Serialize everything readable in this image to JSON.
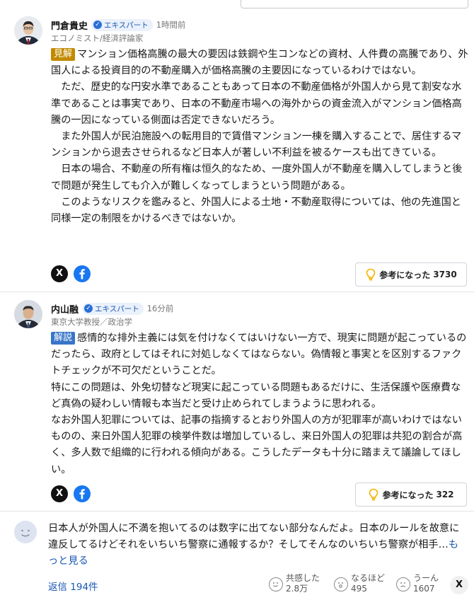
{
  "comments": [
    {
      "name": "門倉貴史",
      "badge": "エキスパート",
      "time": "1時間前",
      "subtitle": "エコノミスト/経済評論家",
      "tag": "見解",
      "paragraphs": [
        "マンション価格高騰の最大の要因は鉄鋼や生コンなどの資材、人件費の高騰であり、外国人による投資目的の不動産購入が価格高騰の主要因になっているわけではない。",
        "　ただ、歴史的な円安水準であることもあって日本の不動産価格が外国人から見て割安な水準であることは事実であり、日本の不動産市場への海外からの資金流入がマンション価格高騰の一因になっている側面は否定できないだろう。",
        "　また外国人が民泊施設への転用目的で賃借マンション一棟を購入することで、居住するマンションから退去させられるなど日本人が著しい不利益を被るケースも出てきている。",
        "　日本の場合、不動産の所有権は恒久的なため、一度外国人が不動産を購入してしまうと後で問題が発生しても介入が難しくなってしまうという問題がある。",
        "　このようなリスクを鑑みると、外国人による土地・不動産取得については、他の先進国と同様一定の制限をかけるべきではないか。"
      ],
      "share_x": "X",
      "useful_label": "参考になった",
      "useful_count": "3730"
    },
    {
      "name": "内山融",
      "badge": "エキスパート",
      "time": "16分前",
      "subtitle": "東京大学教授／政治学",
      "tag": "解説",
      "paragraphs": [
        "感情的な排外主義には気を付けなくてはいけない一方で、現実に問題が起こっているのだったら、政府としてはそれに対処しなくてはならない。偽情報と事実とを区別するファクトチェックが不可欠だということだ。",
        "特にこの問題は、外免切替など現実に起こっている問題もあるだけに、生活保護や医療費など真偽の疑わしい情報も本当だと受け止められてしまうように思われる。",
        "なお外国人犯罪については、記事の指摘するとおり外国人の方が犯罪率が高いわけではないものの、来日外国人犯罪の検挙件数は増加しているし、来日外国人の犯罪は共犯の割合が高く、多人数で組織的に行われる傾向がある。こうしたデータも十分に踏まえて議論してほしい。"
      ],
      "share_x": "X",
      "useful_label": "参考になった",
      "useful_count": "322"
    }
  ],
  "user_comment": {
    "text": "日本人が外国人に不満を抱いてるのは数字に出てない部分なんだよ。日本のルールを故意に違反してるけどそれをいちいち警察に通報するか？そしてそんなのいちいち警察が相手…",
    "more": "もっと見る",
    "replies": "返信 194件",
    "reactions": [
      {
        "label": "共感した",
        "count": "2.8万"
      },
      {
        "label": "なるほど",
        "count": "495"
      },
      {
        "label": "うーん",
        "count": "1607"
      }
    ],
    "share_x": "X"
  },
  "colors": {
    "accent_link": "#1a57b3",
    "tag_opinion": "#c28a00",
    "tag_commentary": "#3875c9",
    "useful_bulb": "#f2b400"
  }
}
